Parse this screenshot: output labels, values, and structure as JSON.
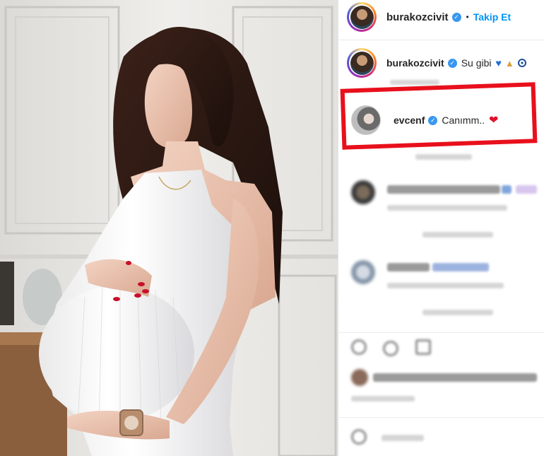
{
  "header": {
    "username": "burakozcivit",
    "separator": "•",
    "follow_label": "Takip Et"
  },
  "caption": {
    "username": "burakozcivit",
    "text": "Su gibi"
  },
  "highlighted_comment": {
    "username": "evcenf",
    "text": "Canımm.."
  },
  "colors": {
    "highlight_border": "#e8101c",
    "follow_blue": "#0095f6",
    "verified_blue": "#3897f0"
  },
  "icons": [
    "verified-badge-icon",
    "blue-heart-emoji-icon",
    "candle-emoji-icon",
    "nazar-eye-emoji-icon",
    "red-heart-emoji-icon",
    "like-icon",
    "comment-icon",
    "share-icon"
  ]
}
